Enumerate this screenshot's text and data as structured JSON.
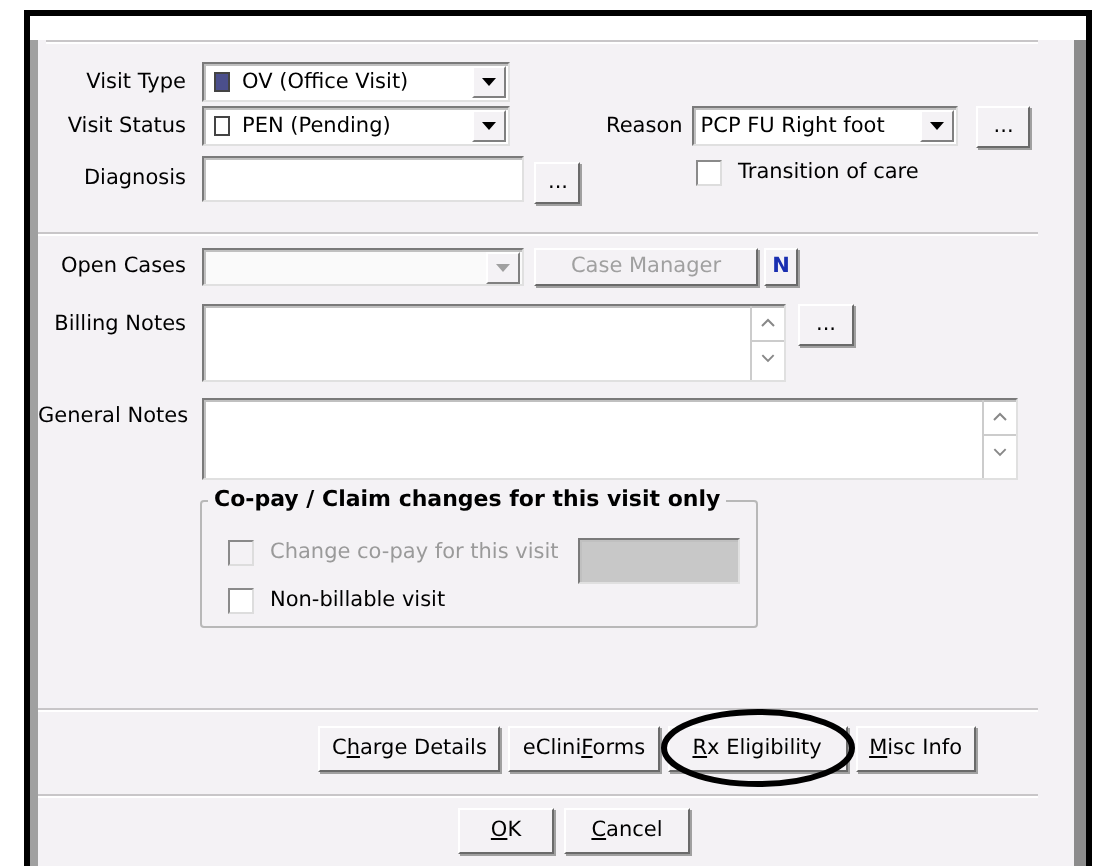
{
  "visit_type": {
    "label": "Visit Type",
    "value": "OV (Office Visit)",
    "color": "#4b4f8c"
  },
  "visit_status": {
    "label": "Visit Status",
    "value": "PEN (Pending)",
    "color": "#ffffff"
  },
  "reason": {
    "label": "Reason",
    "value": "PCP FU Right foot",
    "button": "..."
  },
  "diagnosis": {
    "label": "Diagnosis",
    "button": "..."
  },
  "transition_of_care": {
    "label": "Transition of care",
    "checked": false
  },
  "open_cases": {
    "label": "Open Cases",
    "disabled": true
  },
  "case_manager_button": {
    "label": "Case Manager",
    "disabled": true
  },
  "new_case_button": {
    "label": "N"
  },
  "billing_notes": {
    "label": "Billing Notes",
    "button": "..."
  },
  "general_notes": {
    "label": "General Notes"
  },
  "copay_group": {
    "title": "Co-pay / Claim changes for this visit only",
    "copay_field_disabled": true,
    "options": [
      {
        "label": "Change co-pay for this visit",
        "checked": false,
        "disabled": true
      },
      {
        "label": "Non-billable visit",
        "checked": false,
        "disabled": false
      }
    ]
  },
  "tab_buttons": [
    {
      "before": "C",
      "key": "h",
      "after": "arge Details",
      "highlighted": false
    },
    {
      "before": "eClini",
      "key": "F",
      "after": "orms",
      "highlighted": false
    },
    {
      "key": "R",
      "after": "x Eligibility",
      "highlighted": true
    },
    {
      "key": "M",
      "after": "isc Info",
      "highlighted": false
    }
  ],
  "dialog_buttons": [
    {
      "key": "O",
      "after": "K"
    },
    {
      "key": "C",
      "after": "ancel"
    }
  ]
}
